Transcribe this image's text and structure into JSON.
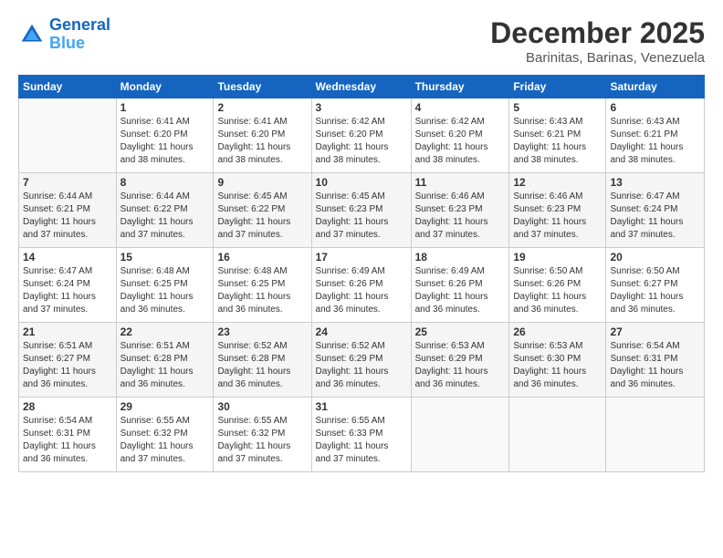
{
  "logo": {
    "line1": "General",
    "line2": "Blue"
  },
  "title": "December 2025",
  "subtitle": "Barinitas, Barinas, Venezuela",
  "days_of_week": [
    "Sunday",
    "Monday",
    "Tuesday",
    "Wednesday",
    "Thursday",
    "Friday",
    "Saturday"
  ],
  "weeks": [
    [
      {
        "num": "",
        "info": ""
      },
      {
        "num": "1",
        "info": "Sunrise: 6:41 AM\nSunset: 6:20 PM\nDaylight: 11 hours\nand 38 minutes."
      },
      {
        "num": "2",
        "info": "Sunrise: 6:41 AM\nSunset: 6:20 PM\nDaylight: 11 hours\nand 38 minutes."
      },
      {
        "num": "3",
        "info": "Sunrise: 6:42 AM\nSunset: 6:20 PM\nDaylight: 11 hours\nand 38 minutes."
      },
      {
        "num": "4",
        "info": "Sunrise: 6:42 AM\nSunset: 6:20 PM\nDaylight: 11 hours\nand 38 minutes."
      },
      {
        "num": "5",
        "info": "Sunrise: 6:43 AM\nSunset: 6:21 PM\nDaylight: 11 hours\nand 38 minutes."
      },
      {
        "num": "6",
        "info": "Sunrise: 6:43 AM\nSunset: 6:21 PM\nDaylight: 11 hours\nand 38 minutes."
      }
    ],
    [
      {
        "num": "7",
        "info": "Sunrise: 6:44 AM\nSunset: 6:21 PM\nDaylight: 11 hours\nand 37 minutes."
      },
      {
        "num": "8",
        "info": "Sunrise: 6:44 AM\nSunset: 6:22 PM\nDaylight: 11 hours\nand 37 minutes."
      },
      {
        "num": "9",
        "info": "Sunrise: 6:45 AM\nSunset: 6:22 PM\nDaylight: 11 hours\nand 37 minutes."
      },
      {
        "num": "10",
        "info": "Sunrise: 6:45 AM\nSunset: 6:23 PM\nDaylight: 11 hours\nand 37 minutes."
      },
      {
        "num": "11",
        "info": "Sunrise: 6:46 AM\nSunset: 6:23 PM\nDaylight: 11 hours\nand 37 minutes."
      },
      {
        "num": "12",
        "info": "Sunrise: 6:46 AM\nSunset: 6:23 PM\nDaylight: 11 hours\nand 37 minutes."
      },
      {
        "num": "13",
        "info": "Sunrise: 6:47 AM\nSunset: 6:24 PM\nDaylight: 11 hours\nand 37 minutes."
      }
    ],
    [
      {
        "num": "14",
        "info": "Sunrise: 6:47 AM\nSunset: 6:24 PM\nDaylight: 11 hours\nand 37 minutes."
      },
      {
        "num": "15",
        "info": "Sunrise: 6:48 AM\nSunset: 6:25 PM\nDaylight: 11 hours\nand 36 minutes."
      },
      {
        "num": "16",
        "info": "Sunrise: 6:48 AM\nSunset: 6:25 PM\nDaylight: 11 hours\nand 36 minutes."
      },
      {
        "num": "17",
        "info": "Sunrise: 6:49 AM\nSunset: 6:26 PM\nDaylight: 11 hours\nand 36 minutes."
      },
      {
        "num": "18",
        "info": "Sunrise: 6:49 AM\nSunset: 6:26 PM\nDaylight: 11 hours\nand 36 minutes."
      },
      {
        "num": "19",
        "info": "Sunrise: 6:50 AM\nSunset: 6:26 PM\nDaylight: 11 hours\nand 36 minutes."
      },
      {
        "num": "20",
        "info": "Sunrise: 6:50 AM\nSunset: 6:27 PM\nDaylight: 11 hours\nand 36 minutes."
      }
    ],
    [
      {
        "num": "21",
        "info": "Sunrise: 6:51 AM\nSunset: 6:27 PM\nDaylight: 11 hours\nand 36 minutes."
      },
      {
        "num": "22",
        "info": "Sunrise: 6:51 AM\nSunset: 6:28 PM\nDaylight: 11 hours\nand 36 minutes."
      },
      {
        "num": "23",
        "info": "Sunrise: 6:52 AM\nSunset: 6:28 PM\nDaylight: 11 hours\nand 36 minutes."
      },
      {
        "num": "24",
        "info": "Sunrise: 6:52 AM\nSunset: 6:29 PM\nDaylight: 11 hours\nand 36 minutes."
      },
      {
        "num": "25",
        "info": "Sunrise: 6:53 AM\nSunset: 6:29 PM\nDaylight: 11 hours\nand 36 minutes."
      },
      {
        "num": "26",
        "info": "Sunrise: 6:53 AM\nSunset: 6:30 PM\nDaylight: 11 hours\nand 36 minutes."
      },
      {
        "num": "27",
        "info": "Sunrise: 6:54 AM\nSunset: 6:31 PM\nDaylight: 11 hours\nand 36 minutes."
      }
    ],
    [
      {
        "num": "28",
        "info": "Sunrise: 6:54 AM\nSunset: 6:31 PM\nDaylight: 11 hours\nand 36 minutes."
      },
      {
        "num": "29",
        "info": "Sunrise: 6:55 AM\nSunset: 6:32 PM\nDaylight: 11 hours\nand 37 minutes."
      },
      {
        "num": "30",
        "info": "Sunrise: 6:55 AM\nSunset: 6:32 PM\nDaylight: 11 hours\nand 37 minutes."
      },
      {
        "num": "31",
        "info": "Sunrise: 6:55 AM\nSunset: 6:33 PM\nDaylight: 11 hours\nand 37 minutes."
      },
      {
        "num": "",
        "info": ""
      },
      {
        "num": "",
        "info": ""
      },
      {
        "num": "",
        "info": ""
      }
    ]
  ]
}
